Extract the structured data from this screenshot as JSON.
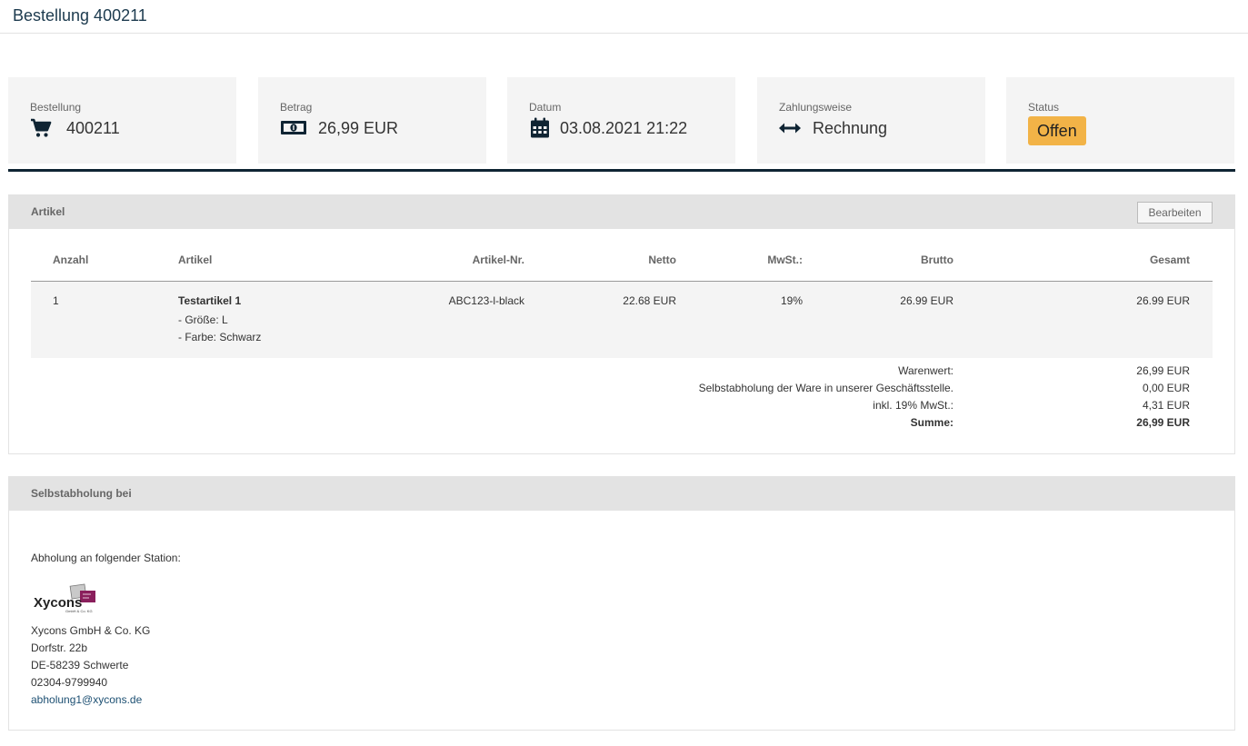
{
  "page": {
    "title": "Bestellung 400211"
  },
  "cards": {
    "order": {
      "label": "Bestellung",
      "value": "400211",
      "icon": "shopping-cart-icon"
    },
    "amount": {
      "label": "Betrag",
      "value": "26,99 EUR",
      "icon": "money-bill-icon"
    },
    "date": {
      "label": "Datum",
      "value": "03.08.2021 21:22",
      "icon": "calendar-icon"
    },
    "payment": {
      "label": "Zahlungsweise",
      "value": "Rechnung",
      "icon": "arrows-left-right-icon"
    },
    "status": {
      "label": "Status",
      "value": "Offen",
      "color": "#f2b347"
    }
  },
  "accent_color": "#0f2433",
  "articles": {
    "title": "Artikel",
    "edit_label": "Bearbeiten",
    "columns": {
      "qty": "Anzahl",
      "article": "Artikel",
      "sku": "Artikel-Nr.",
      "net": "Netto",
      "vat": "MwSt.:",
      "gross": "Brutto",
      "total": "Gesamt"
    },
    "rows": [
      {
        "qty": "1",
        "name": "Testartikel 1",
        "options": [
          "- Größe: L",
          "- Farbe: Schwarz"
        ],
        "sku": "ABC123-l-black",
        "net": "22.68 EUR",
        "vat": "19%",
        "gross": "26.99 EUR",
        "total": "26.99 EUR"
      }
    ],
    "summary": [
      {
        "label": "Warenwert:",
        "value": "26,99 EUR"
      },
      {
        "label": "Selbstabholung der Ware in unserer Geschäftsstelle.",
        "value": "0,00 EUR"
      },
      {
        "label": "inkl. 19% MwSt.:",
        "value": "4,31 EUR"
      },
      {
        "label": "Summe:",
        "value": "26,99 EUR"
      }
    ]
  },
  "pickup": {
    "title": "Selbstabholung bei",
    "intro": "Abholung an folgender Station:",
    "logo_text": "Xycons",
    "logo_subtext": "GmbH & Co. KG",
    "company": "Xycons GmbH & Co. KG",
    "street": "Dorfstr. 22b",
    "city": "DE-58239 Schwerte",
    "phone": "02304-9799940",
    "email": "abholung1@xycons.de"
  }
}
